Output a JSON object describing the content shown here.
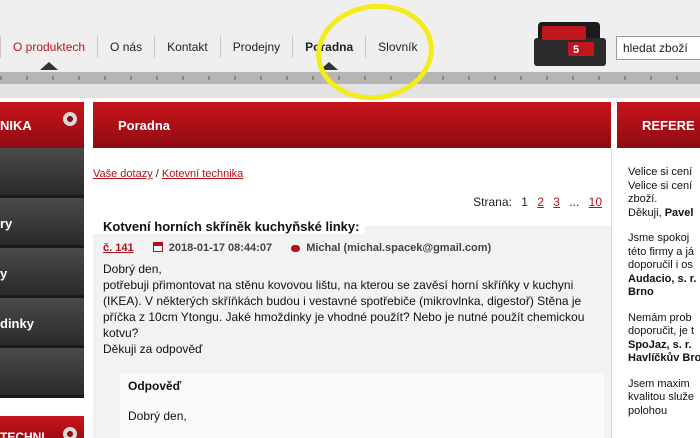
{
  "nav": {
    "items": [
      {
        "label": "O produktech"
      },
      {
        "label": "O nás"
      },
      {
        "label": "Kontakt"
      },
      {
        "label": "Prodejny"
      },
      {
        "label": "Poradna"
      },
      {
        "label": "Slovník"
      }
    ]
  },
  "search": {
    "value": "hledat zboží"
  },
  "left": {
    "header": "NIKA",
    "items": [
      "",
      "ry",
      "y",
      "dinky",
      ""
    ],
    "header2": "TECHNI"
  },
  "main": {
    "header": "Poradna",
    "breadcrumb": {
      "link1": "Vaše dotazy",
      "sep": "/",
      "link2": "Kotevní technika"
    },
    "pager": {
      "label": "Strana:",
      "current": "1",
      "pages": [
        "2",
        "3"
      ],
      "ellipsis": "...",
      "last": "10"
    },
    "question": {
      "title": "Kotvení horních skříněk kuchyňské linky:",
      "number": "č. 141",
      "date": "2018-01-17 08:44:07",
      "author": "Michal (michal.spacek@gmail.com)",
      "body": [
        "Dobrý den,",
        "potřebuji přimontovat na stěnu kovovou lištu, na kterou se zavěsí horní skříňky v kuchyni",
        "(IKEA). V některých skříňkách budou i vestavné spotřebiče (mikrovlnka, digestoř) Stěna je",
        "příčka z 10cm Ytongu. Jaké hmoždinky je vhodné použít? Nebo je nutné použít chemickou",
        "kotvu?",
        "Děkuji za odpověď"
      ]
    },
    "answer": {
      "title": "Odpověď",
      "text": "Dobrý den,"
    }
  },
  "right": {
    "header": "REFERE",
    "ref1": [
      "Velice si cení",
      "Velice si cení",
      "zboží."
    ],
    "ref1_sign_prefix": "Děkuji,",
    "ref1_sign": "Pavel",
    "ref2": [
      "Jsme spokoj",
      "této firmy a já",
      "doporučil i os"
    ],
    "ref2_company": [
      "Audacio, s. r.",
      "Brno"
    ],
    "ref3": [
      "Nemám prob",
      "doporučit, je t"
    ],
    "ref3_company": [
      "SpoJaz, s. r.",
      "Havlíčkův Bro"
    ],
    "ref4": [
      "Jsem maxim",
      "kvalitou služe",
      "polohou"
    ]
  }
}
